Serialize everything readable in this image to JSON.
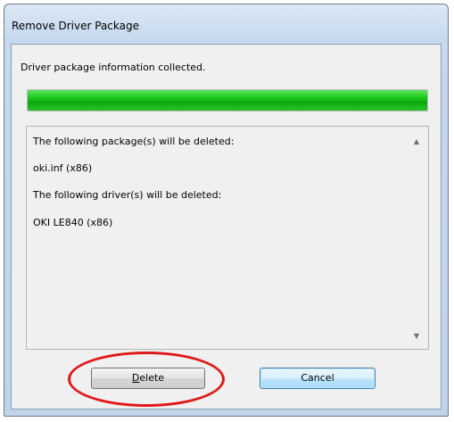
{
  "window": {
    "title": "Remove Driver Package"
  },
  "status": {
    "message": "Driver package information collected.",
    "progress_percent": 100,
    "progress_color": "#19c519"
  },
  "details": {
    "lines": [
      "The following package(s) will be deleted:",
      "oki.inf (x86)",
      "The following driver(s) will be deleted:",
      "OKI LE840 (x86)"
    ],
    "scroll_up_icon": "scroll-up-arrow",
    "scroll_down_icon": "scroll-down-arrow"
  },
  "buttons": {
    "delete_accel": "D",
    "delete_rest": "elete",
    "cancel": "Cancel"
  },
  "annotation": {
    "highlight_color": "#e01818"
  }
}
